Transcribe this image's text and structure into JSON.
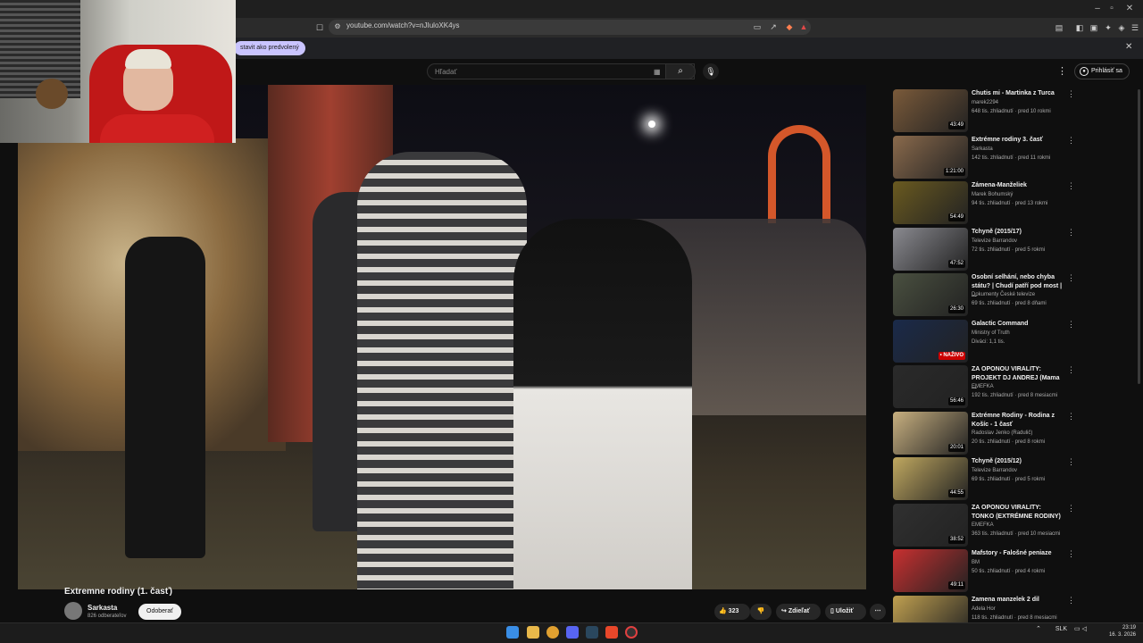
{
  "browser": {
    "url": "youtube.com/watch?v=nJIuloXK4ys",
    "info_button": "stavit ako predvolený",
    "close_label": "✕"
  },
  "header": {
    "search_placeholder": "Hľadať",
    "sign_in": "Prihlásiť sa"
  },
  "video": {
    "title": "Extremne rodiny (1. časť)",
    "channel": "Sarkasta",
    "subscribers": "826 odberateľov",
    "subscribe": "Odoberať",
    "likes": "323",
    "share": "Zdieľať",
    "save": "Uložiť",
    "more": "⋯"
  },
  "recommendations": [
    {
      "title": "Chutis mi - Martinka z Turca",
      "channel": "marek2294",
      "meta": "648 tis. zhliadnutí · pred 10 rokmi",
      "duration": "43:49",
      "thumb": "#7a5a3a"
    },
    {
      "title": "Extrémne rodiny 3. časť",
      "channel": "Sarkasta",
      "meta": "142 tis. zhliadnutí · pred 11 rokmi",
      "duration": "1:21:00",
      "thumb": "#8a6a4c"
    },
    {
      "title": "Zámena-Manželiek",
      "channel": "Marek Bohumský",
      "meta": "94 tis. zhliadnutí · pred 13 rokmi",
      "duration": "54:49",
      "thumb": "#6a5a20"
    },
    {
      "title": "Tchyně (2015/17)",
      "channel": "Televize Barrandov",
      "meta": "72 tis. zhliadnutí · pred 5 rokmi",
      "duration": "47:52",
      "thumb": "#8a8a90"
    },
    {
      "title": "Osobní selhání, nebo chyba státu? | Chudí patří pod most | ...",
      "channel": "Dokumenty České televize",
      "meta": "69 tis. zhliadnutí · pred 8 dňami",
      "duration": "26:30",
      "thumb": "#4a5040"
    },
    {
      "title": "Galactic Command",
      "channel": "Ministry of Truth",
      "meta": "Diváci: 1,1 tis.",
      "duration": "",
      "live": "• NAŽIVO",
      "thumb": "#1a2a4a"
    },
    {
      "title": "ZA OPONOU VIRALITY: PROJEKT DJ ANDREJ (Mama ...",
      "channel": "EMEFKA",
      "meta": "192 tis. zhliadnutí · pred 8 mesiacmi",
      "duration": "56:46",
      "thumb": "#2a2a2a"
    },
    {
      "title": "Extrémne Rodiny - Rodina z Košíc - 1 časť",
      "channel": "Radoslav Jenko (Radulič)",
      "meta": "20 tis. zhliadnutí · pred 8 rokmi",
      "duration": "20:01",
      "thumb": "#c8b080"
    },
    {
      "title": "Tchyně (2015/12)",
      "channel": "Televize Barrandov",
      "meta": "69 tis. zhliadnutí · pred 5 rokmi",
      "duration": "44:55",
      "thumb": "#c0a860"
    },
    {
      "title": "ZA OPONOU VIRALITY: TONKO (EXTRÉMNE RODINY)",
      "channel": "EMEFKA",
      "meta": "363 tis. zhliadnutí · pred 10 mesiacmi",
      "duration": "38:52",
      "thumb": "#303030"
    },
    {
      "title": "Mafstory - Falošné peniaze",
      "channel": "BM",
      "meta": "50 tis. zhliadnutí · pred 4 rokmi",
      "duration": "49:11",
      "thumb": "#c83030"
    },
    {
      "title": "Zamena manzelek 2 dil",
      "channel": "Adela Hor",
      "meta": "118 tis. zhliadnutí · pred 8 mesiacmi",
      "duration": "",
      "thumb": "#c0a050"
    }
  ],
  "taskbar": {
    "language": "SLK",
    "time": "23:19",
    "date": "16. 3. 2026"
  }
}
